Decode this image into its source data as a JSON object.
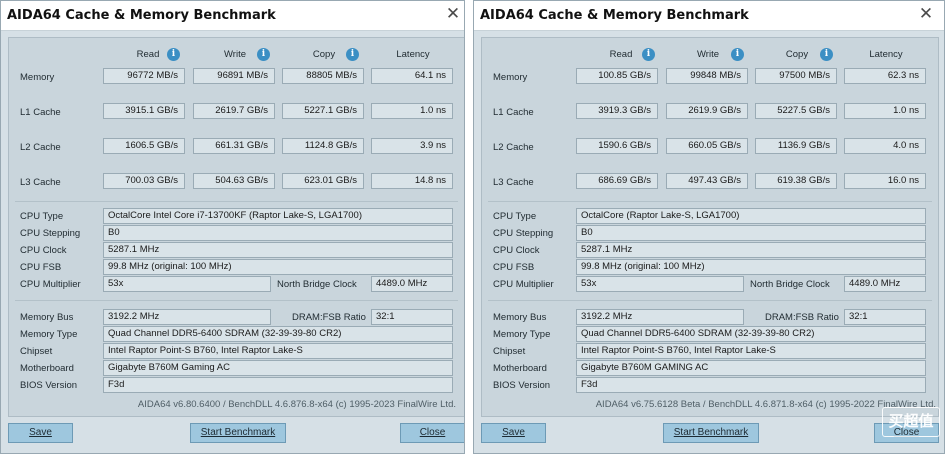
{
  "left": {
    "title": "AIDA64 Cache & Memory Benchmark",
    "headers": {
      "read": "Read",
      "write": "Write",
      "copy": "Copy",
      "latency": "Latency"
    },
    "rows": [
      {
        "label": "Memory",
        "read": "96772 MB/s",
        "write": "96891 MB/s",
        "copy": "88805 MB/s",
        "latency": "64.1 ns"
      },
      {
        "label": "L1 Cache",
        "read": "3915.1 GB/s",
        "write": "2619.7 GB/s",
        "copy": "5227.1 GB/s",
        "latency": "1.0 ns"
      },
      {
        "label": "L2 Cache",
        "read": "1606.5 GB/s",
        "write": "661.31 GB/s",
        "copy": "1124.8 GB/s",
        "latency": "3.9 ns"
      },
      {
        "label": "L3 Cache",
        "read": "700.03 GB/s",
        "write": "504.63 GB/s",
        "copy": "623.01 GB/s",
        "latency": "14.8 ns"
      }
    ],
    "cpu": {
      "type_label": "CPU Type",
      "type": "OctalCore Intel Core i7-13700KF  (Raptor Lake-S, LGA1700)",
      "stepping_label": "CPU Stepping",
      "stepping": "B0",
      "clock_label": "CPU Clock",
      "clock": "5287.1 MHz",
      "fsb_label": "CPU FSB",
      "fsb": "99.8 MHz  (original: 100 MHz)",
      "multiplier_label": "CPU Multiplier",
      "multiplier": "53x",
      "nb_clock_label": "North Bridge Clock",
      "nb_clock": "4489.0 MHz"
    },
    "mem": {
      "bus_label": "Memory Bus",
      "bus": "3192.2 MHz",
      "ratio_label": "DRAM:FSB Ratio",
      "ratio": "32:1",
      "type_label": "Memory Type",
      "type": "Quad Channel DDR5-6400 SDRAM  (32-39-39-80 CR2)",
      "chipset_label": "Chipset",
      "chipset": "Intel Raptor Point-S B760, Intel Raptor Lake-S",
      "board_label": "Motherboard",
      "board": "Gigabyte B760M Gaming AC",
      "bios_label": "BIOS Version",
      "bios": "F3d"
    },
    "footer": "AIDA64 v6.80.6400 / BenchDLL 4.6.876.8-x64  (c) 1995-2023 FinalWire Ltd.",
    "buttons": {
      "save": "Save",
      "start": "Start Benchmark",
      "close": "Close"
    }
  },
  "right": {
    "title": "AIDA64 Cache & Memory Benchmark",
    "headers": {
      "read": "Read",
      "write": "Write",
      "copy": "Copy",
      "latency": "Latency"
    },
    "rows": [
      {
        "label": "Memory",
        "read": "100.85 GB/s",
        "write": "99848 MB/s",
        "copy": "97500 MB/s",
        "latency": "62.3 ns"
      },
      {
        "label": "L1 Cache",
        "read": "3919.3 GB/s",
        "write": "2619.9 GB/s",
        "copy": "5227.5 GB/s",
        "latency": "1.0 ns"
      },
      {
        "label": "L2 Cache",
        "read": "1590.6 GB/s",
        "write": "660.05 GB/s",
        "copy": "1136.9 GB/s",
        "latency": "4.0 ns"
      },
      {
        "label": "L3 Cache",
        "read": "686.69 GB/s",
        "write": "497.43 GB/s",
        "copy": "619.38 GB/s",
        "latency": "16.0 ns"
      }
    ],
    "cpu": {
      "type_label": "CPU Type",
      "type": "OctalCore   (Raptor Lake-S, LGA1700)",
      "stepping_label": "CPU Stepping",
      "stepping": "B0",
      "clock_label": "CPU Clock",
      "clock": "5287.1 MHz",
      "fsb_label": "CPU FSB",
      "fsb": "99.8 MHz  (original: 100 MHz)",
      "multiplier_label": "CPU Multiplier",
      "multiplier": "53x",
      "nb_clock_label": "North Bridge Clock",
      "nb_clock": "4489.0 MHz"
    },
    "mem": {
      "bus_label": "Memory Bus",
      "bus": "3192.2 MHz",
      "ratio_label": "DRAM:FSB Ratio",
      "ratio": "32:1",
      "type_label": "Memory Type",
      "type": "Quad Channel DDR5-6400 SDRAM  (32-39-39-80 CR2)",
      "chipset_label": "Chipset",
      "chipset": "Intel Raptor Point-S B760, Intel Raptor Lake-S",
      "board_label": "Motherboard",
      "board": "Gigabyte B760M GAMING AC",
      "bios_label": "BIOS Version",
      "bios": "F3d"
    },
    "footer": "AIDA64 v6.75.6128 Beta / BenchDLL 4.6.871.8-x64  (c) 1995-2022 FinalWire Ltd.",
    "buttons": {
      "save": "Save",
      "start": "Start Benchmark",
      "close": "Close"
    }
  },
  "watermark": "买超值",
  "icons": {
    "close": "close-icon",
    "info": "info-icon"
  }
}
